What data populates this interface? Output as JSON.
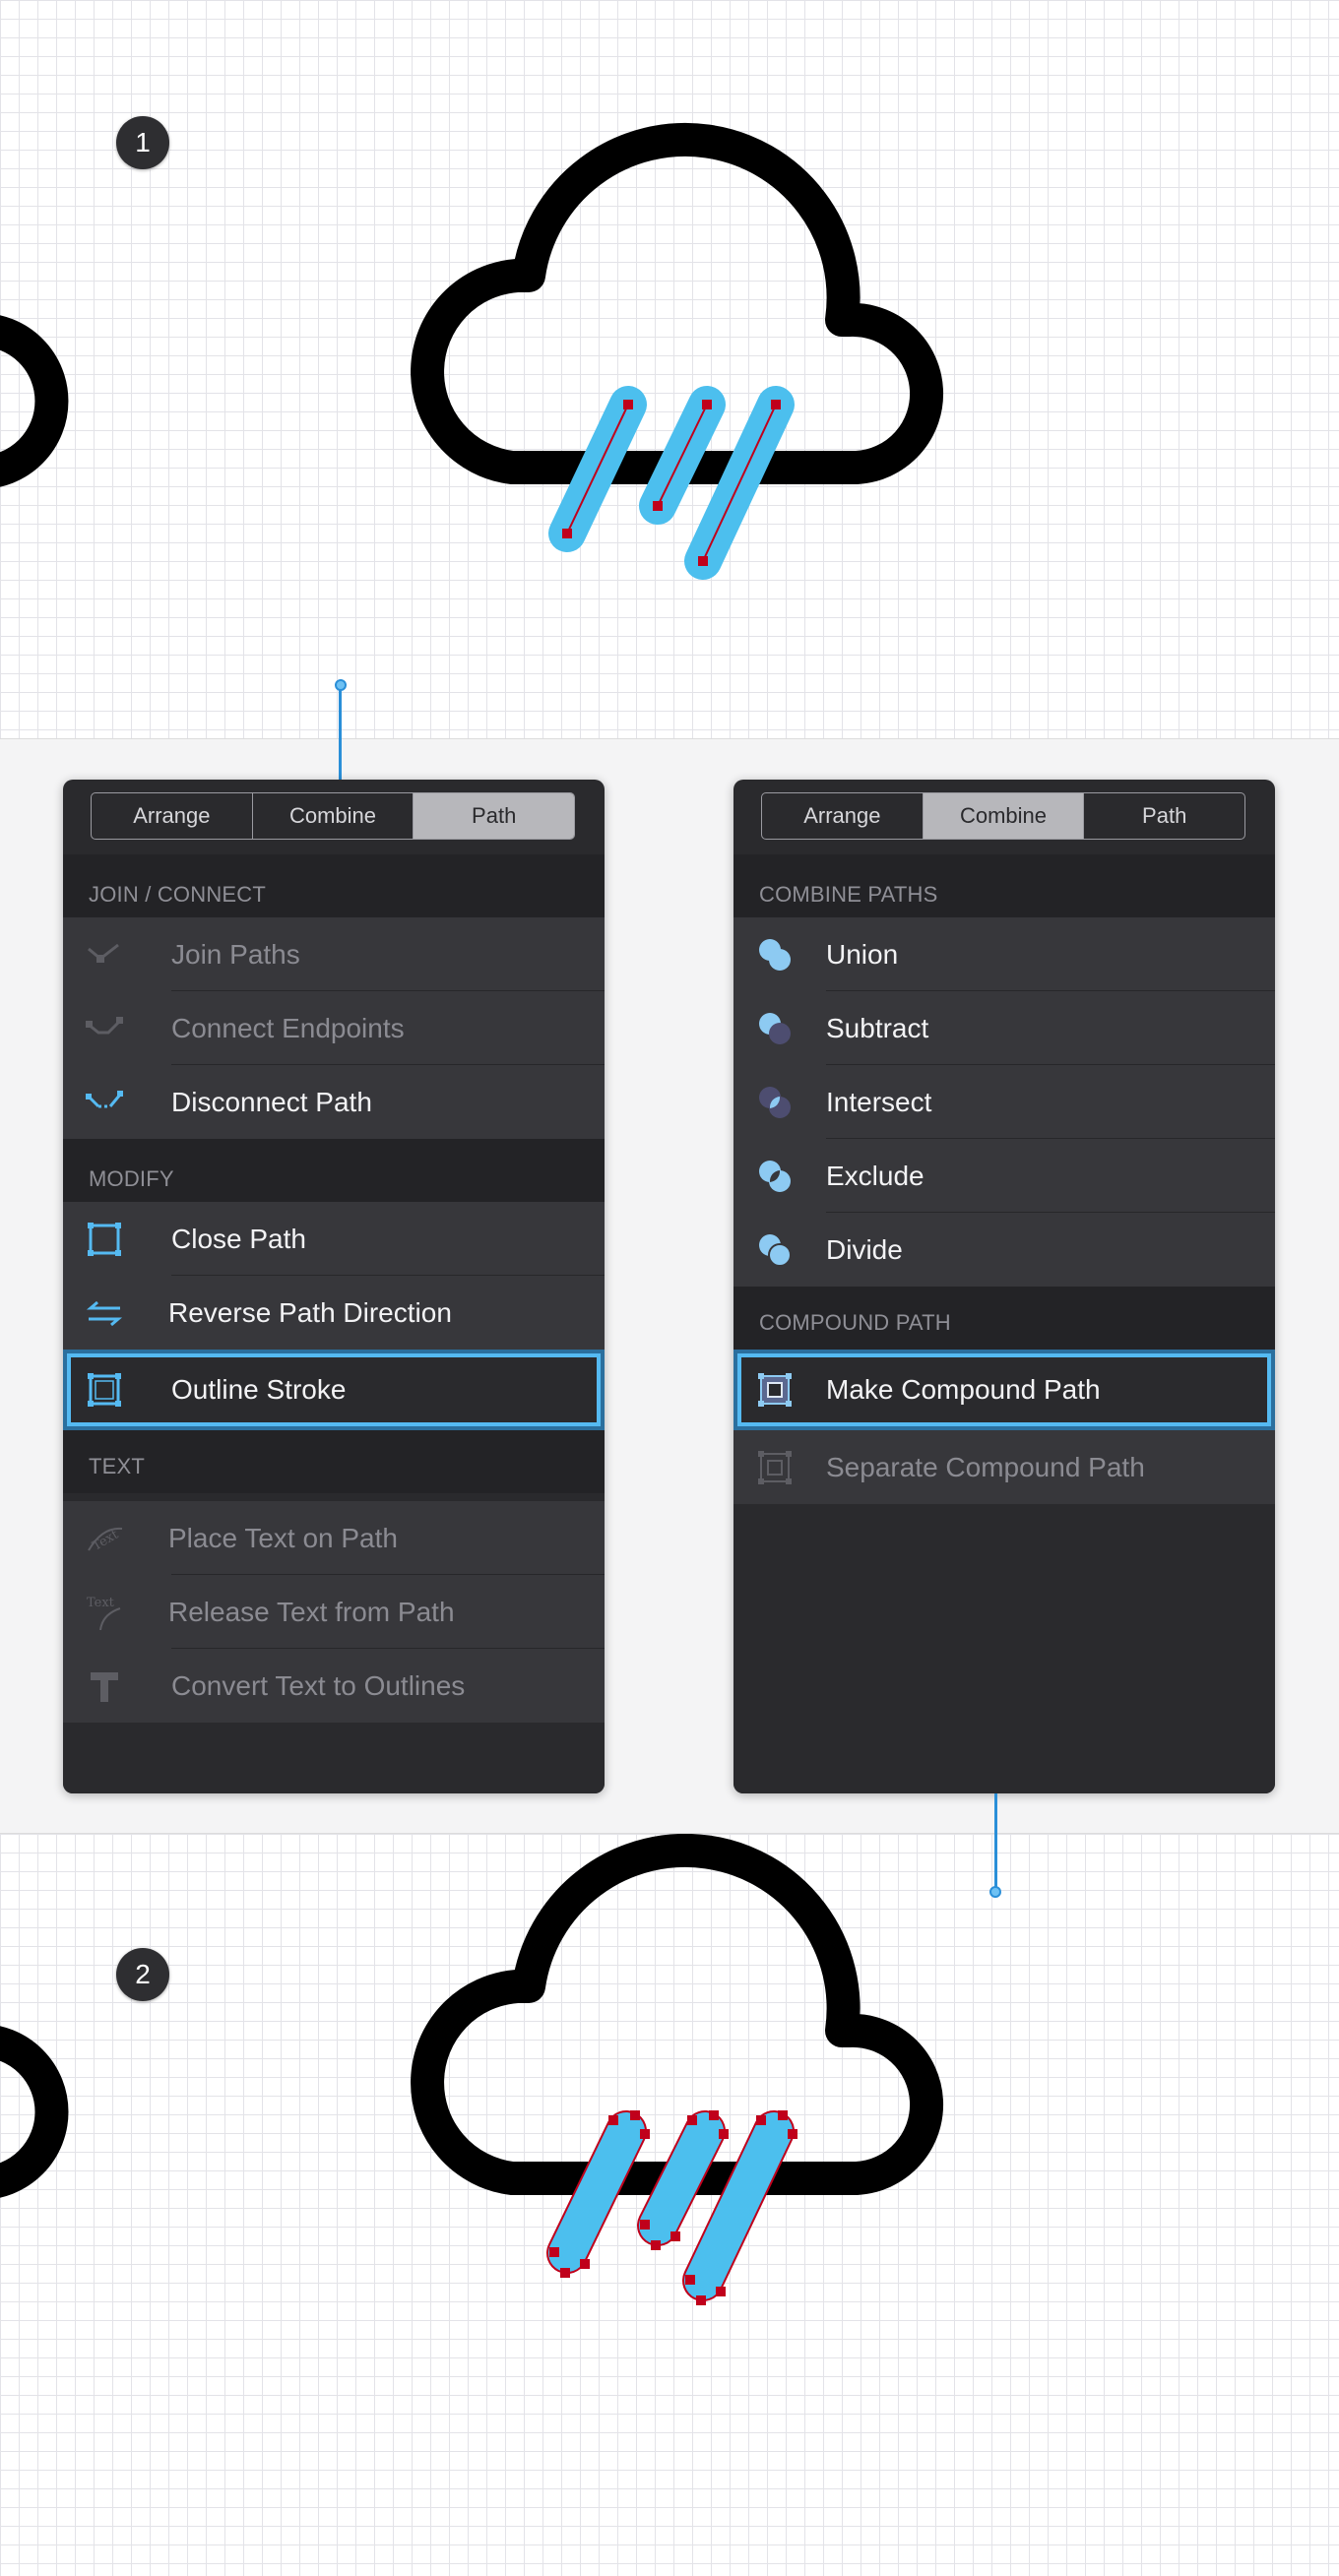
{
  "steps": {
    "first": "1",
    "second": "2"
  },
  "colors": {
    "accent": "#55baf2",
    "rain_fill": "#4cbfee",
    "anchor_point": "#c0001b",
    "panel_bg": "#2a2a2d",
    "row_bg": "#37373b"
  },
  "left_panel": {
    "tabs": [
      "Arrange",
      "Combine",
      "Path"
    ],
    "active_tab": "Path",
    "sections": [
      {
        "header": "JOIN / CONNECT",
        "items": [
          {
            "label": "Join Paths",
            "icon": "join-paths-icon",
            "enabled": false
          },
          {
            "label": "Connect Endpoints",
            "icon": "connect-endpoints-icon",
            "enabled": false
          },
          {
            "label": "Disconnect Path",
            "icon": "disconnect-path-icon",
            "enabled": true
          }
        ]
      },
      {
        "header": "MODIFY",
        "items": [
          {
            "label": "Close Path",
            "icon": "close-path-icon",
            "enabled": true
          },
          {
            "label": "Reverse Path Direction",
            "icon": "reverse-direction-icon",
            "enabled": true
          },
          {
            "label": "Outline Stroke",
            "icon": "outline-stroke-icon",
            "enabled": true,
            "highlighted": true
          }
        ]
      },
      {
        "header": "TEXT",
        "items": [
          {
            "label": "Place Text on Path",
            "icon": "text-on-path-icon",
            "enabled": false
          },
          {
            "label": "Release Text from Path",
            "icon": "release-text-icon",
            "enabled": false
          },
          {
            "label": "Convert Text to Outlines",
            "icon": "text-outlines-icon",
            "enabled": false
          }
        ]
      }
    ]
  },
  "right_panel": {
    "tabs": [
      "Arrange",
      "Combine",
      "Path"
    ],
    "active_tab": "Combine",
    "sections": [
      {
        "header": "COMBINE PATHS",
        "items": [
          {
            "label": "Union",
            "icon": "union-icon",
            "enabled": true
          },
          {
            "label": "Subtract",
            "icon": "subtract-icon",
            "enabled": true
          },
          {
            "label": "Intersect",
            "icon": "intersect-icon",
            "enabled": true
          },
          {
            "label": "Exclude",
            "icon": "exclude-icon",
            "enabled": true
          },
          {
            "label": "Divide",
            "icon": "divide-icon",
            "enabled": true
          }
        ]
      },
      {
        "header": "COMPOUND PATH",
        "items": [
          {
            "label": "Make Compound Path",
            "icon": "compound-path-icon",
            "enabled": true,
            "highlighted": true
          },
          {
            "label": "Separate Compound Path",
            "icon": "separate-compound-icon",
            "enabled": false
          }
        ]
      }
    ]
  }
}
